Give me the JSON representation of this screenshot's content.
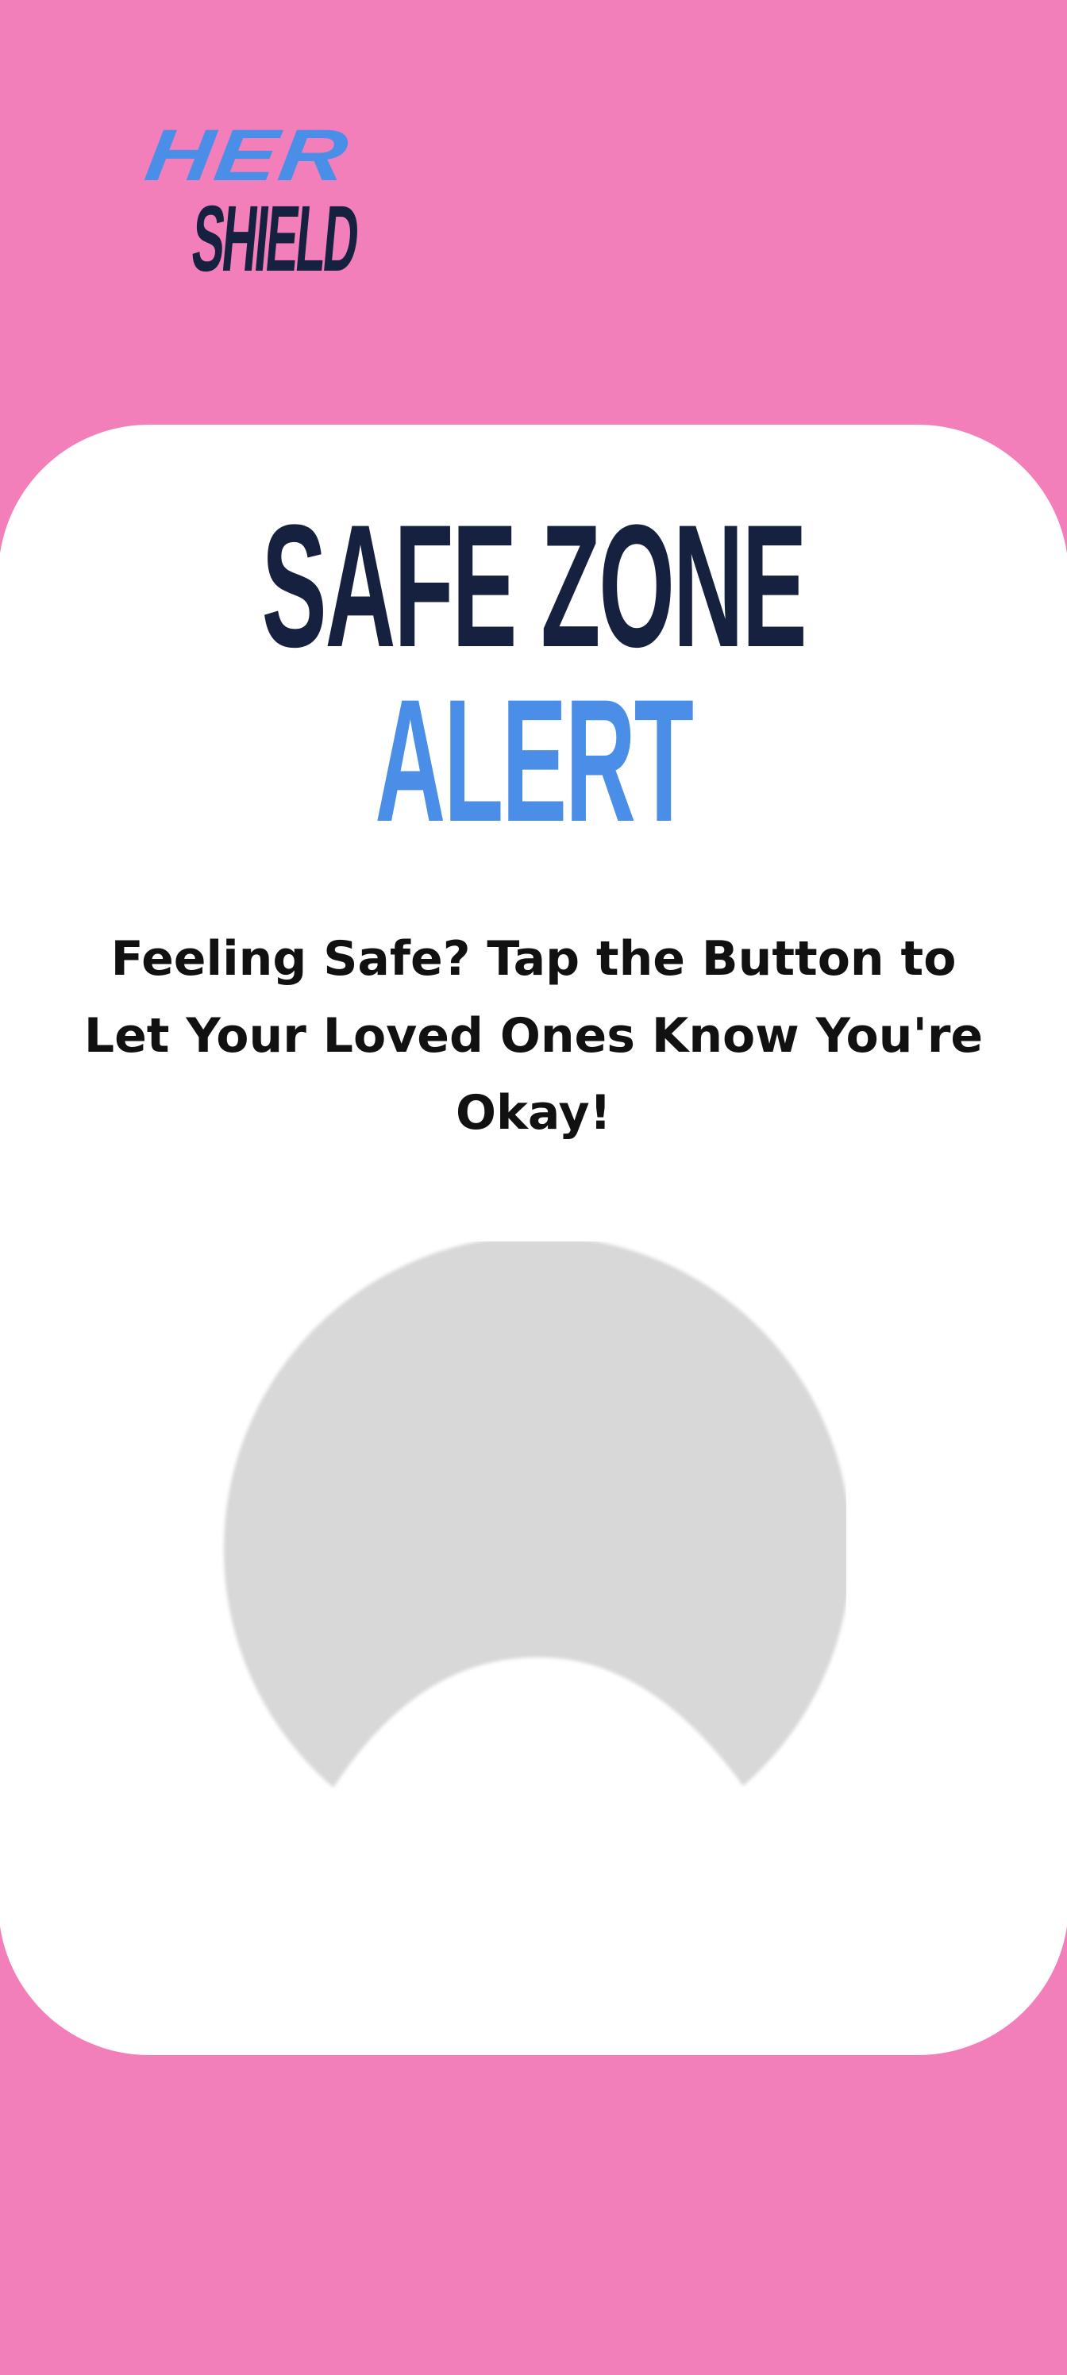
{
  "brand": {
    "logo_top": "HER",
    "logo_bottom": "SHIELD"
  },
  "title": {
    "line1": "SAFE ZONE",
    "line2": "ALERT"
  },
  "message": "Feeling Safe? Tap the Button to Let Your Loved Ones Know You're Okay!",
  "button": {
    "icon": "safe-alert-button-shape"
  },
  "colors": {
    "background": "#F27FBA",
    "card": "#FFFFFF",
    "navy": "#16203F",
    "blue": "#4A8EE8",
    "button_gray": "#D8D8D8"
  }
}
